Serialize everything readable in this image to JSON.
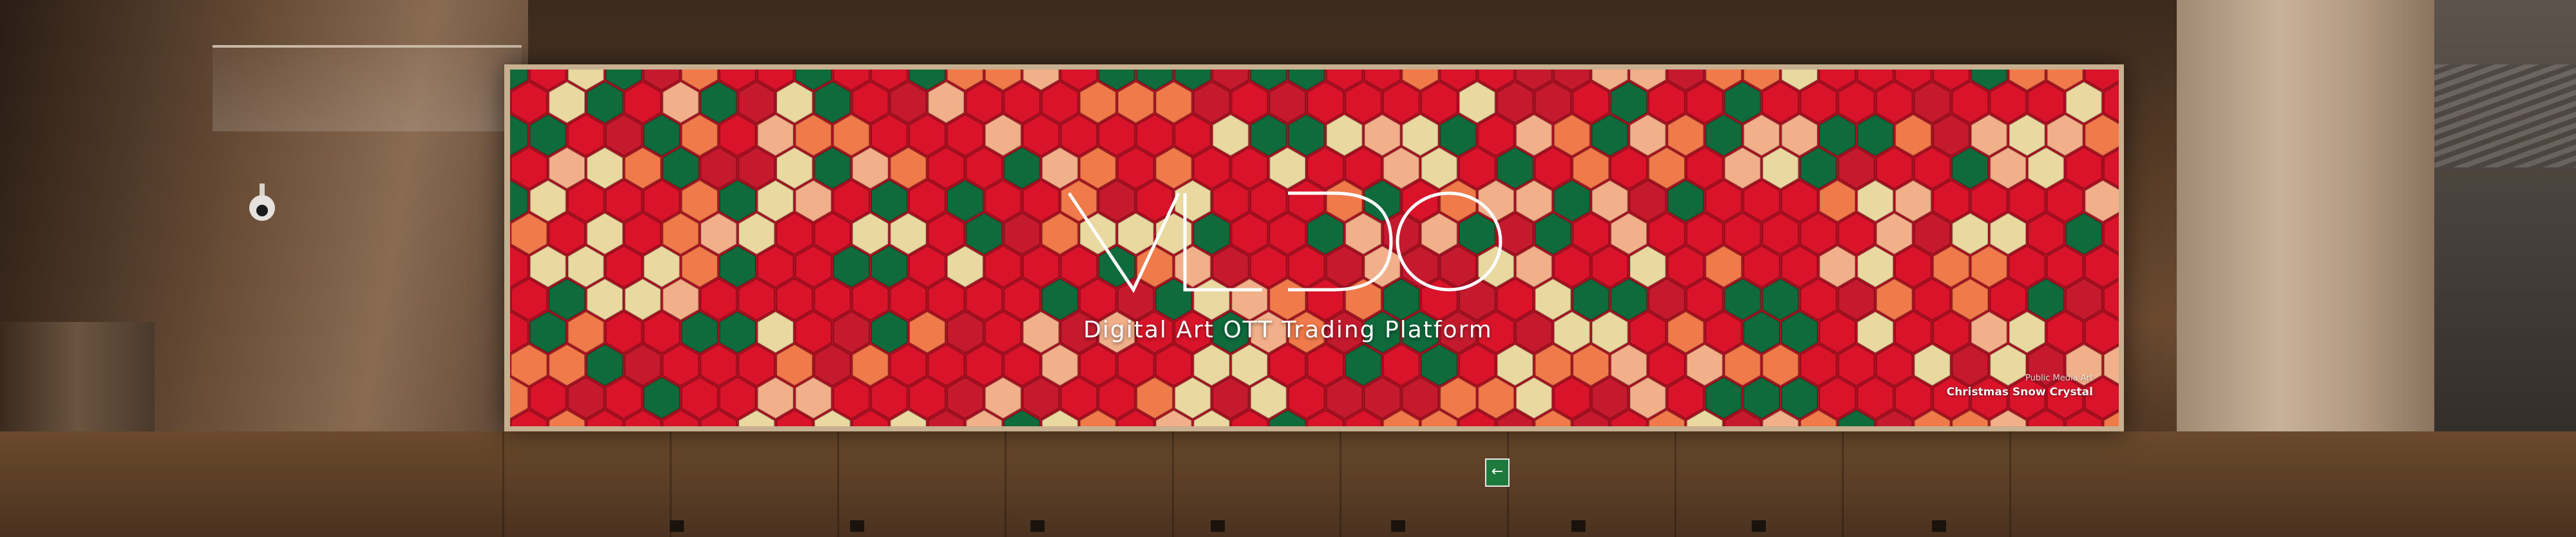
{
  "banner": {
    "logo_text": "VLDO",
    "tagline": "Digital Art OTT Trading Platform",
    "credit_category": "Public Media Art",
    "credit_title": "Christmas Snow Crystal"
  },
  "colors": {
    "hex_red": "#d9142a",
    "hex_green": "#0f6b3c",
    "hex_cream": "#e9d9a0",
    "hex_orange": "#f07a4a",
    "frame": "#c7b08f"
  },
  "icons": {
    "exit_sign": "exit-arrow-icon",
    "camera": "security-camera-icon"
  }
}
